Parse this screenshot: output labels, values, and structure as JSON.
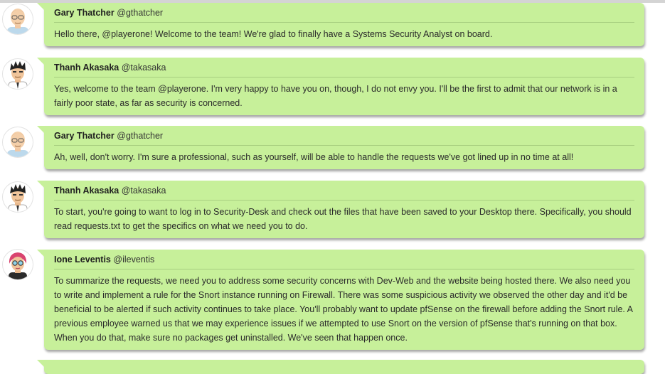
{
  "colors": {
    "bubble": "#c7f09a",
    "divider": "#a8cf80",
    "topbar": "#d4d4d4"
  },
  "messages": [
    {
      "avatar_icon": "bald-man-glasses-avatar-icon",
      "name": "Gary Thatcher",
      "handle": "@gthatcher",
      "text": "Hello there, @playerone! Welcome to the team! We're glad to finally have a Systems Security Analyst on board."
    },
    {
      "avatar_icon": "spiky-hair-man-avatar-icon",
      "name": "Thanh Akasaka",
      "handle": "@takasaka",
      "text": "Yes, welcome to the team @playerone. I'm very happy to have you on, though, I do not envy you. I'll be the first to admit that our network is in a fairly poor state, as far as security is concerned."
    },
    {
      "avatar_icon": "bald-man-glasses-avatar-icon",
      "name": "Gary Thatcher",
      "handle": "@gthatcher",
      "text": "Ah, well, don't worry. I'm sure a professional, such as yourself, will be able to handle the requests we've got lined up in no time at all!"
    },
    {
      "avatar_icon": "spiky-hair-man-avatar-icon",
      "name": "Thanh Akasaka",
      "handle": "@takasaka",
      "text": "To start, you're going to want to log in to Security-Desk and check out the files that have been saved to your Desktop there. Specifically, you should read requests.txt to get the specifics on what we need you to do."
    },
    {
      "avatar_icon": "pink-hair-woman-glasses-avatar-icon",
      "name": "Ione Leventis",
      "handle": "@ileventis",
      "text": "To summarize the requests, we need you to address some security concerns with Dev-Web and the website being hosted there. We also need you to write and implement a rule for the Snort instance running on Firewall. There was some suspicious activity we observed the other day and it'd be beneficial to be alerted if such activity continues to take place. You'll probably want to update pfSense on the firewall before adding the Snort rule. A previous employee warned us that we may experience issues if we attempted to use Snort on the version of pfSense that's running on that box. When you do that, make sure no packages get uninstalled. We've seen that happen once."
    }
  ]
}
